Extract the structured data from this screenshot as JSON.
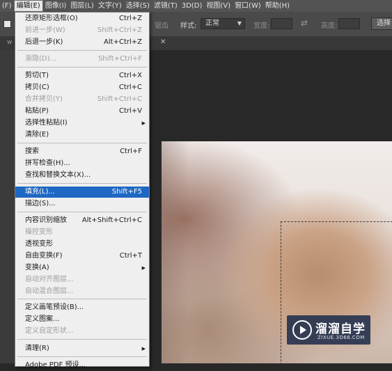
{
  "menubar": {
    "items": [
      "(F)",
      "编辑(E)",
      "图像(I)",
      "图层(L)",
      "文字(Y)",
      "选择(S)",
      "滤镜(T)",
      "3D(D)",
      "视图(V)",
      "窗口(W)",
      "帮助(H)"
    ]
  },
  "options": {
    "antialias_label": "锯齿",
    "style_label": "样式:",
    "style_value": "正常",
    "width_label": "宽度:",
    "height_label": "高度:",
    "select_button": "选择"
  },
  "tabs": {
    "fragment": "w"
  },
  "edit_menu": {
    "items": [
      {
        "label": "还原矩形选框(O)",
        "shortcut": "Ctrl+Z",
        "enabled": true
      },
      {
        "label": "前进一步(W)",
        "shortcut": "Shift+Ctrl+Z",
        "enabled": false
      },
      {
        "label": "后退一步(K)",
        "shortcut": "Alt+Ctrl+Z",
        "enabled": true
      },
      {
        "label": "渐隐(D)...",
        "shortcut": "Shift+Ctrl+F",
        "enabled": false
      },
      {
        "label": "剪切(T)",
        "shortcut": "Ctrl+X",
        "enabled": true
      },
      {
        "label": "拷贝(C)",
        "shortcut": "Ctrl+C",
        "enabled": true
      },
      {
        "label": "合并拷贝(Y)",
        "shortcut": "Shift+Ctrl+C",
        "enabled": false
      },
      {
        "label": "粘贴(P)",
        "shortcut": "Ctrl+V",
        "enabled": true
      },
      {
        "label": "选择性粘贴(I)",
        "shortcut": "",
        "enabled": true,
        "submenu": true
      },
      {
        "label": "清除(E)",
        "shortcut": "",
        "enabled": true
      },
      {
        "label": "搜索",
        "shortcut": "Ctrl+F",
        "enabled": true
      },
      {
        "label": "拼写检查(H)...",
        "shortcut": "",
        "enabled": true
      },
      {
        "label": "查找和替换文本(X)...",
        "shortcut": "",
        "enabled": true
      },
      {
        "label": "填充(L)...",
        "shortcut": "Shift+F5",
        "enabled": true,
        "highlighted": true
      },
      {
        "label": "描边(S)...",
        "shortcut": "",
        "enabled": true
      },
      {
        "label": "内容识别缩放",
        "shortcut": "Alt+Shift+Ctrl+C",
        "enabled": true
      },
      {
        "label": "操控变形",
        "shortcut": "",
        "enabled": false
      },
      {
        "label": "透视变形",
        "shortcut": "",
        "enabled": true
      },
      {
        "label": "自由变换(F)",
        "shortcut": "Ctrl+T",
        "enabled": true
      },
      {
        "label": "变换(A)",
        "shortcut": "",
        "enabled": true,
        "submenu": true
      },
      {
        "label": "自动对齐图层...",
        "shortcut": "",
        "enabled": false
      },
      {
        "label": "自动混合图层...",
        "shortcut": "",
        "enabled": false
      },
      {
        "label": "定义画笔预设(B)...",
        "shortcut": "",
        "enabled": true
      },
      {
        "label": "定义图案...",
        "shortcut": "",
        "enabled": true
      },
      {
        "label": "定义自定形状...",
        "shortcut": "",
        "enabled": false
      },
      {
        "label": "清理(R)",
        "shortcut": "",
        "enabled": true,
        "submenu": true
      },
      {
        "label": "Adobe PDF 预设...",
        "shortcut": "",
        "enabled": true
      }
    ]
  },
  "watermark": {
    "title": "溜溜自学",
    "subtitle": "ZIXUE.3D66.COM"
  },
  "colors": {
    "menu_highlight": "#1e68c3",
    "menubar_bg": "#535353",
    "menu_bg": "#efefef"
  }
}
